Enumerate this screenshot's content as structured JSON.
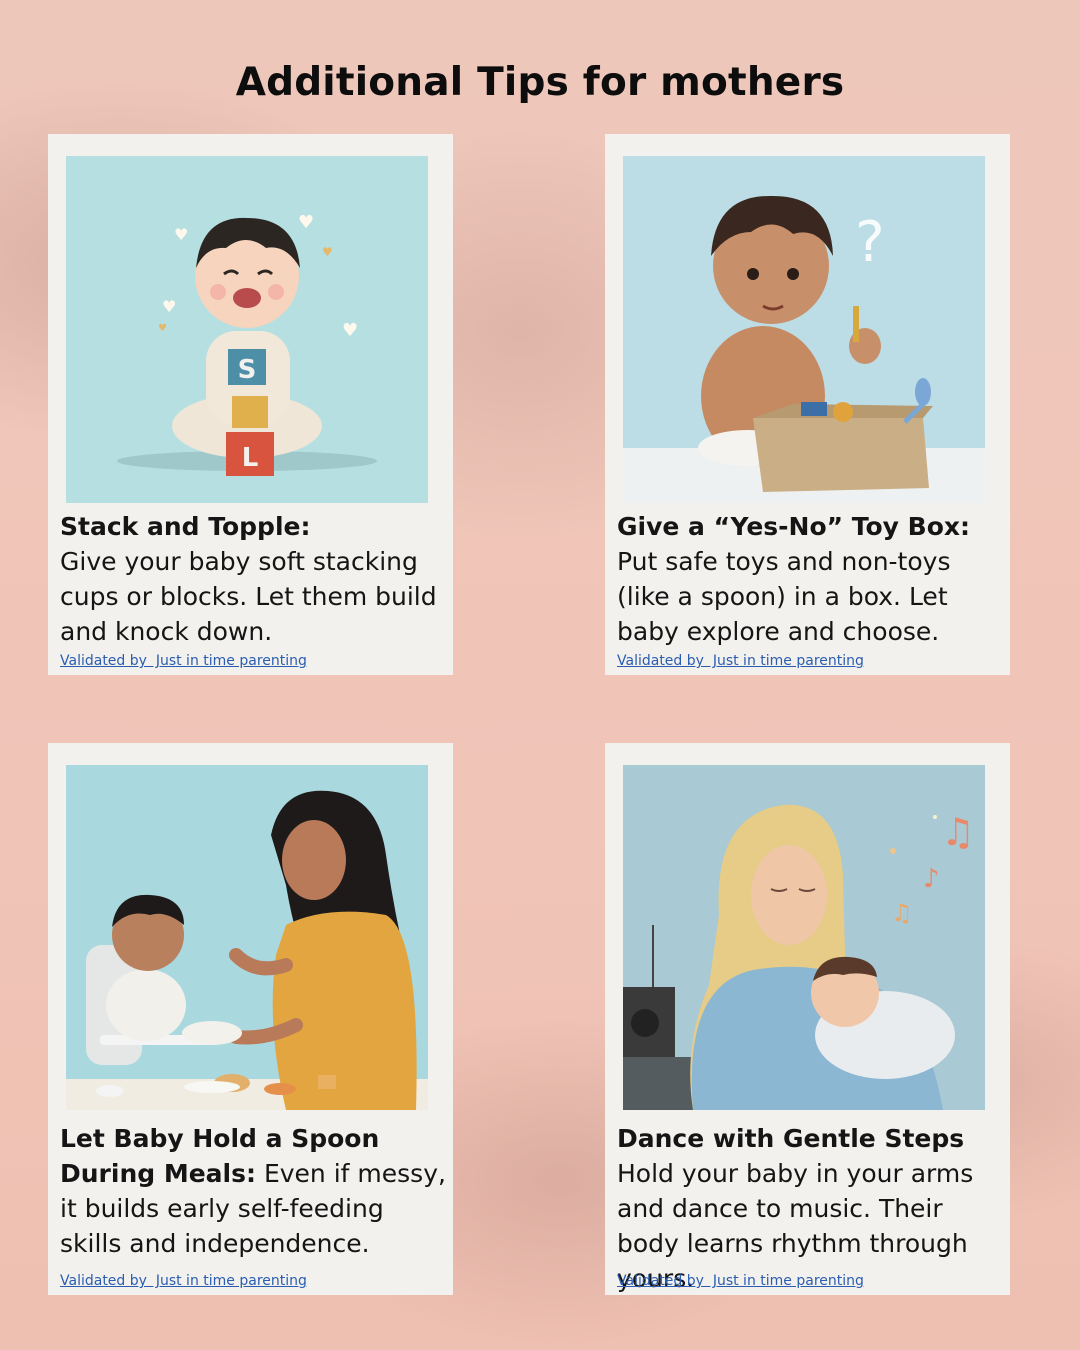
{
  "page": {
    "title": "Additional Tips for mothers"
  },
  "cards": [
    {
      "title": "Stack and Topple:",
      "body": "Give your baby soft stacking cups or blocks. Let them build and knock down.",
      "credit": "Validated by  Just in time parenting",
      "illustration": "baby-stacking-blocks"
    },
    {
      "title": "Give a “Yes-No” Toy Box:",
      "body": "Put safe toys and non-toys (like a spoon) in a box. Let baby explore and choose.",
      "credit": "Validated by  Just in time parenting",
      "illustration": "baby-with-toy-box"
    },
    {
      "title": "Let Baby Hold a Spoon During Meals:",
      "body": "Even if messy, it builds early self-feeding skills and independence.",
      "credit": "Validated by  Just in time parenting",
      "illustration": "mother-feeding-baby"
    },
    {
      "title": "Dance with Gentle Steps",
      "body": "Hold your baby in your arms and dance to music. Their body learns rhythm through yours.",
      "credit": "Validated by  Just in time parenting",
      "illustration": "mother-dancing-with-baby"
    }
  ],
  "colors": {
    "background": "#efc1b3",
    "card": "#f3f1ee",
    "illustration_sky": "#b6dde0",
    "link": "#2a5db0"
  },
  "block_letters": [
    "S",
    "L"
  ]
}
